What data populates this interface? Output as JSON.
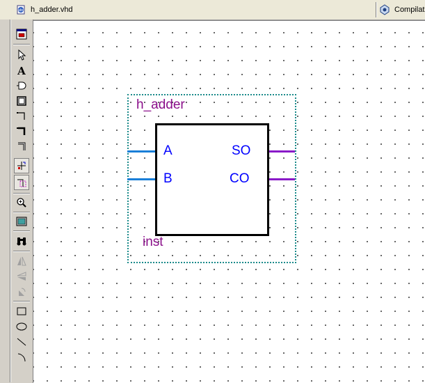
{
  "tabs": [
    {
      "label": "h_adder.vhd",
      "icon": "vhdl-file-icon"
    },
    {
      "label": "Compilati",
      "icon": "compilation-report-icon"
    }
  ],
  "toolbar": {
    "tools": [
      "symbol-editor-icon",
      "selection-tool-icon",
      "text-tool-icon",
      "symbol-tool-icon",
      "block-tool-icon",
      "orthogonal-node-tool-icon",
      "orthogonal-bus-tool-icon",
      "orthogonal-conduit-tool-icon",
      "rubberbanding-icon",
      "partial-line-selection-icon",
      "zoom-tool-icon",
      "full-screen-icon",
      "find-icon",
      "flip-horizontal-icon",
      "flip-vertical-icon",
      "rotate-left-icon",
      "rectangle-tool-icon",
      "oval-tool-icon",
      "line-tool-icon",
      "arc-tool-icon"
    ]
  },
  "symbol": {
    "name": "h_adder",
    "instance": "inst",
    "inputs": [
      "A",
      "B"
    ],
    "outputs": [
      "SO",
      "CO"
    ]
  },
  "colors": {
    "symbol_border": "#1a8a8a",
    "symbol_text": "#8a0f8a",
    "pin_text": "#0000ff",
    "input_wire": "#1a7fd8",
    "output_wire": "#8a1ac8"
  }
}
